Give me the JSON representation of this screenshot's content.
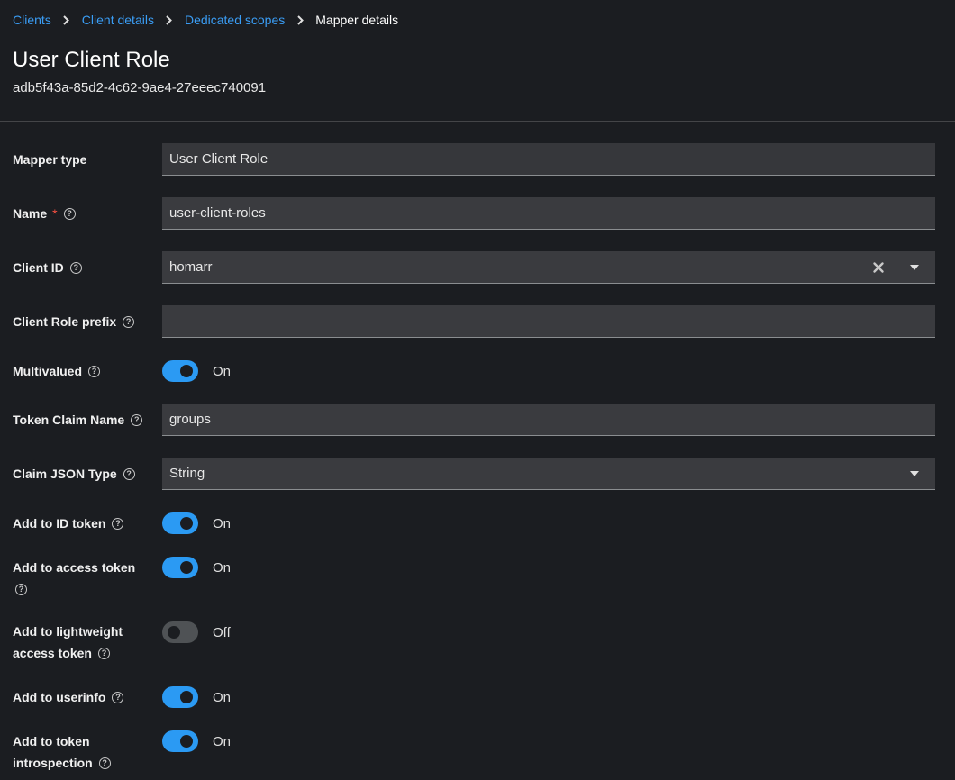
{
  "breadcrumb": {
    "items": [
      "Clients",
      "Client details",
      "Dedicated scopes"
    ],
    "current": "Mapper details"
  },
  "header": {
    "title": "User Client Role",
    "subtitle": "adb5f43a-85d2-4c62-9ae4-27eeec740091"
  },
  "form": {
    "mapper_type": {
      "label": "Mapper type",
      "value": "User Client Role"
    },
    "name": {
      "label": "Name",
      "required": "*",
      "value": "user-client-roles"
    },
    "client_id": {
      "label": "Client ID",
      "value": "homarr"
    },
    "client_role_prefix": {
      "label": "Client Role prefix",
      "value": ""
    },
    "multivalued": {
      "label": "Multivalued",
      "state": "On",
      "on": true
    },
    "token_claim_name": {
      "label": "Token Claim Name",
      "value": "groups"
    },
    "claim_json_type": {
      "label": "Claim JSON Type",
      "value": "String"
    },
    "add_to_id_token": {
      "label": "Add to ID token",
      "state": "On",
      "on": true
    },
    "add_to_access_token": {
      "label": "Add to access token",
      "state": "On",
      "on": true
    },
    "add_to_lightweight": {
      "label_line1": "Add to lightweight",
      "label_line2": "access token",
      "state": "Off",
      "on": false
    },
    "add_to_userinfo": {
      "label": "Add to userinfo",
      "state": "On",
      "on": true
    },
    "add_to_introspection": {
      "label_line1": "Add to token",
      "label_line2": "introspection",
      "state": "On",
      "on": true
    }
  },
  "icons": {
    "help": "help-circle-icon",
    "clear": "close-icon",
    "caret": "caret-down-icon",
    "breadcrumb_separator": "chevron-right-icon"
  },
  "colors": {
    "background": "#1b1d21",
    "link": "#3a9df5",
    "toggle_on": "#2b9af3",
    "toggle_off": "#4f5255",
    "required": "#fe5142"
  },
  "help_glyph": "?"
}
